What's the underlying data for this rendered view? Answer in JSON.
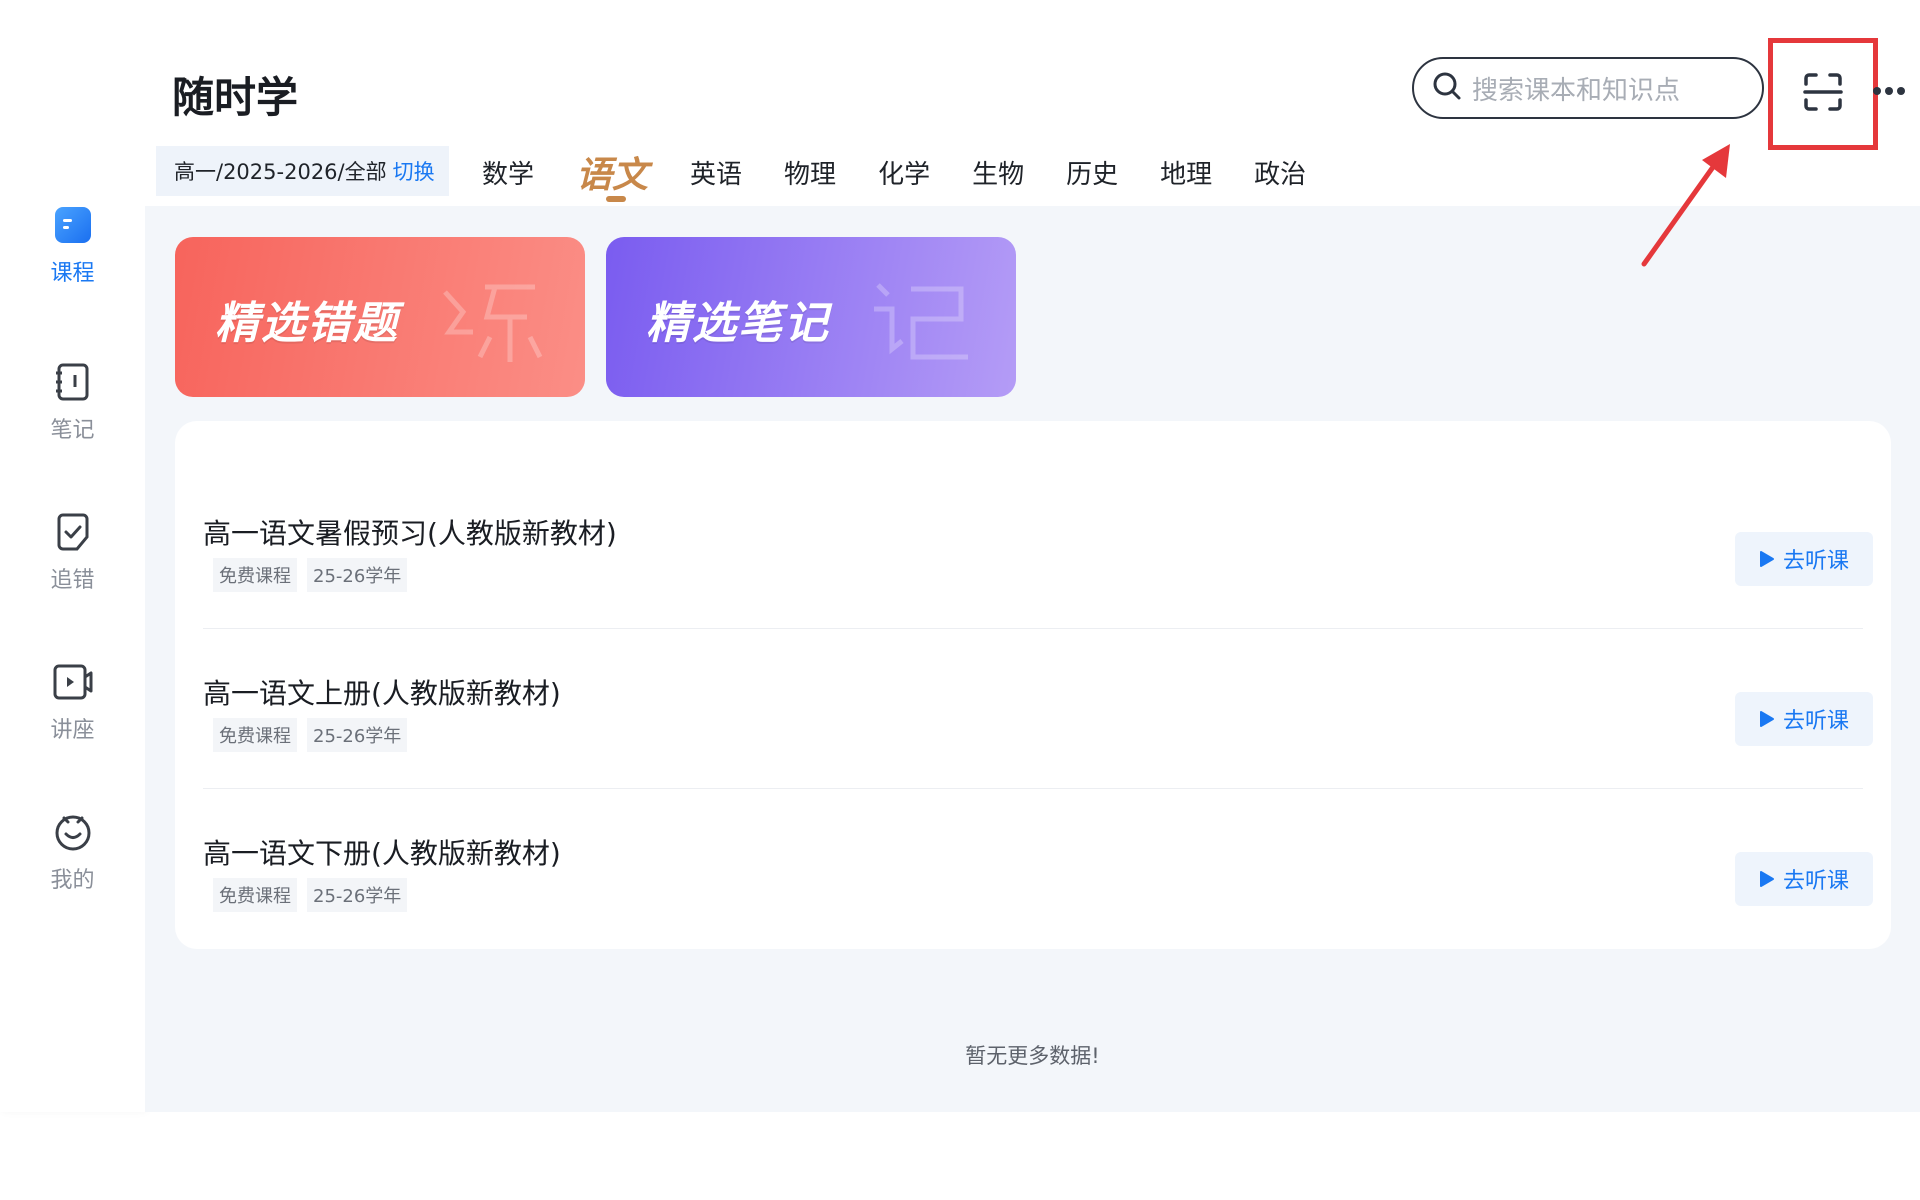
{
  "app": {
    "title": "随时学"
  },
  "sidebar": {
    "items": [
      {
        "id": "course",
        "label": "课程",
        "icon": "course-icon",
        "active": true
      },
      {
        "id": "notes",
        "label": "笔记",
        "icon": "notebook-icon",
        "active": false
      },
      {
        "id": "mistakes",
        "label": "追错",
        "icon": "checkbox-icon",
        "active": false
      },
      {
        "id": "lecture",
        "label": "讲座",
        "icon": "video-camera-icon",
        "active": false
      },
      {
        "id": "mine",
        "label": "我的",
        "icon": "face-icon",
        "active": false
      }
    ]
  },
  "header": {
    "search": {
      "placeholder": "搜索课本和知识点",
      "icon": "search-icon"
    },
    "scan_icon": "scan-icon",
    "more_icon": "more-dots-icon",
    "grade": {
      "text": "高一/2025-2026/全部",
      "switch_label": "切换"
    },
    "tabs": [
      {
        "label": "数学",
        "active": false
      },
      {
        "label": "语文",
        "active": true
      },
      {
        "label": "英语",
        "active": false
      },
      {
        "label": "物理",
        "active": false
      },
      {
        "label": "化学",
        "active": false
      },
      {
        "label": "生物",
        "active": false
      },
      {
        "label": "历史",
        "active": false
      },
      {
        "label": "地理",
        "active": false
      },
      {
        "label": "政治",
        "active": false
      }
    ]
  },
  "feature_cards": [
    {
      "title": "精选错题",
      "watermark": "练"
    },
    {
      "title": "精选笔记",
      "watermark": "记"
    }
  ],
  "courses": [
    {
      "title": "高一语文暑假预习(人教版新教材)",
      "tags": [
        "免费课程",
        "25-26学年"
      ],
      "action": "去听课"
    },
    {
      "title": "高一语文上册(人教版新教材)",
      "tags": [
        "免费课程",
        "25-26学年"
      ],
      "action": "去听课"
    },
    {
      "title": "高一语文下册(人教版新教材)",
      "tags": [
        "免费课程",
        "25-26学年"
      ],
      "action": "去听课"
    }
  ],
  "footer": {
    "no_more": "暂无更多数据!"
  },
  "colors": {
    "accent": "#1a78f2",
    "tab_active": "#c8884a",
    "annotation": "#e5383b"
  }
}
